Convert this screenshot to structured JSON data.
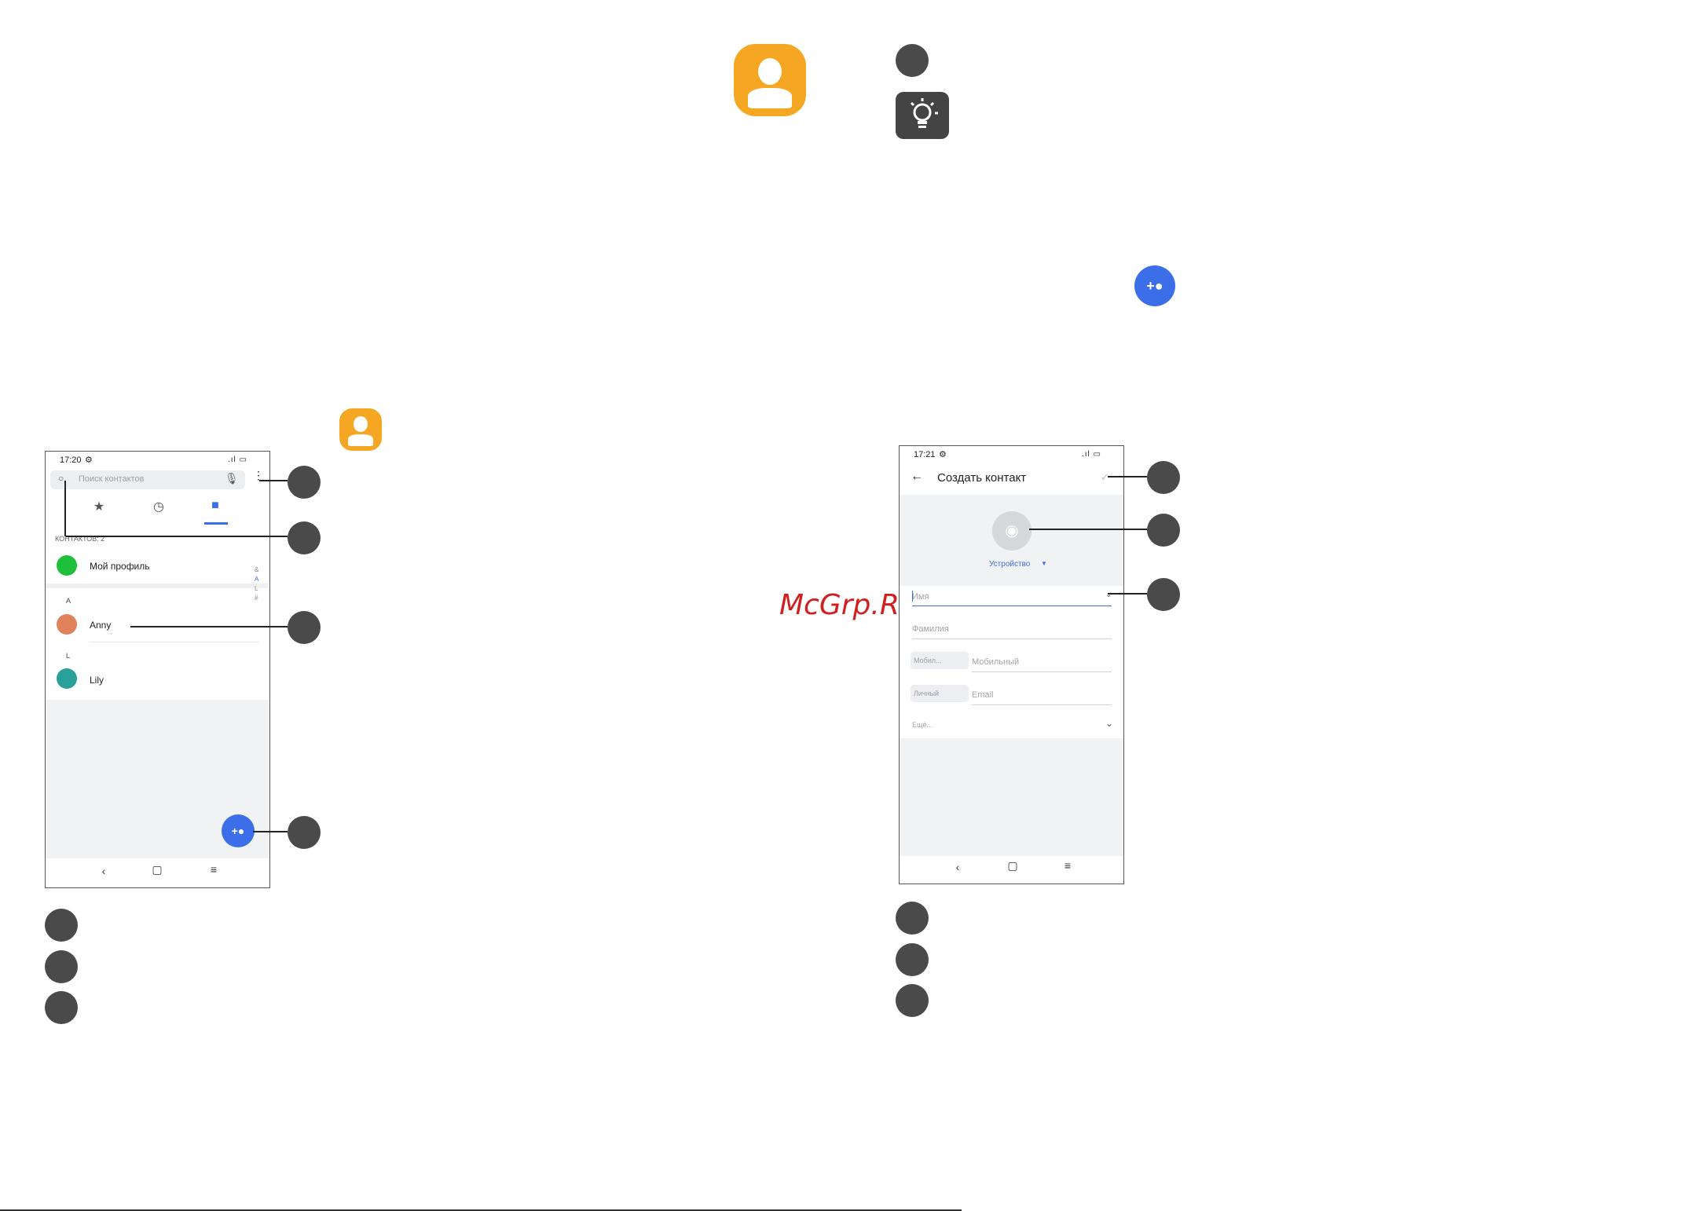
{
  "watermark": "McGrp.Ru",
  "phone1": {
    "status_time": "17:20",
    "search_placeholder": "Поиск контактов",
    "contacts_count": "КОНТАКТОВ: 2",
    "my_profile": "Мой профиль",
    "section_a": "A",
    "contact_1": "Anny",
    "section_l": "L",
    "contact_2": "Lily",
    "index_letters": [
      "&",
      "A",
      "L",
      "#"
    ]
  },
  "phone2": {
    "status_time": "17:21",
    "title": "Создать контакт",
    "account": "Устройство",
    "first_name_placeholder": "Имя",
    "last_name_placeholder": "Фамилия",
    "phone_type": "Мобил...",
    "phone_placeholder": "Мобильный",
    "email_type": "Личный",
    "email_placeholder": "Email",
    "more": "Ещё..."
  },
  "colors": {
    "app_icon": "#f5a623",
    "bullet": "#4a4a4a",
    "accent_blue": "#3b6ee8",
    "profile_green": "#1fbf3c",
    "watermark": "#d11f1f"
  },
  "icons": [
    "contacts-app-icon",
    "tip-lightbulb-icon",
    "add-contact-icon",
    "star-icon",
    "clock-icon",
    "contacts-tab-icon",
    "mic-icon",
    "search-icon",
    "more-icon",
    "camera-icon",
    "back-arrow-icon",
    "check-icon",
    "chevron-down-icon"
  ]
}
